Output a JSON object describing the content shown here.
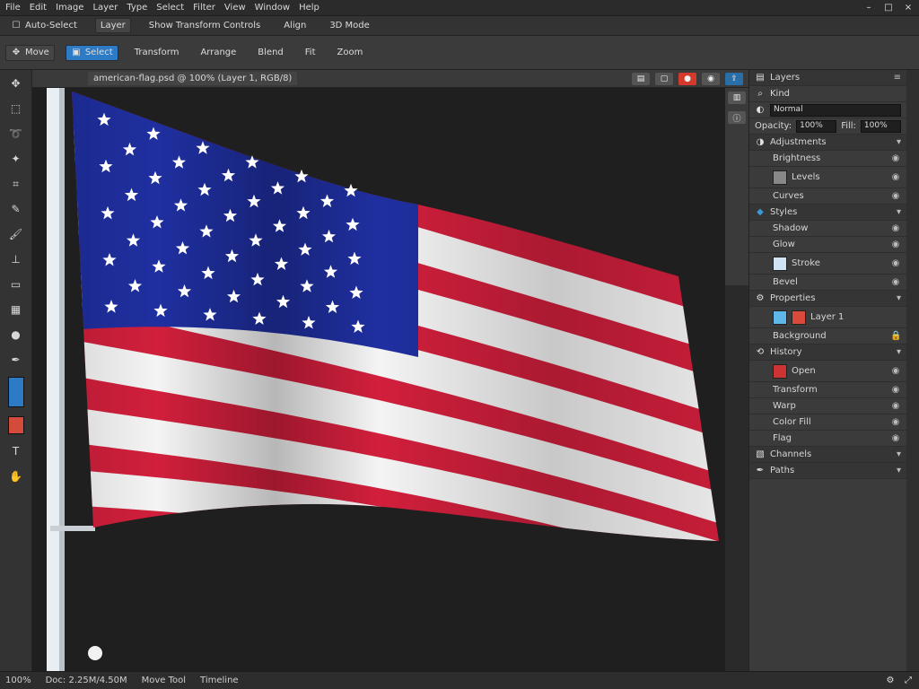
{
  "menubar": {
    "items": [
      "File",
      "Edit",
      "Image",
      "Layer",
      "Type",
      "Select",
      "Filter",
      "View",
      "Window",
      "Help"
    ],
    "window_controls": [
      "minimize",
      "maximize",
      "close"
    ]
  },
  "options_bar": {
    "items": [
      "Auto-Select",
      "Layer",
      "Show Transform Controls",
      "Align",
      "3D Mode"
    ]
  },
  "toolbar2": {
    "buttons": [
      "Move",
      "Select",
      "Transform",
      "Arrange",
      "Blend",
      "Fit",
      "Zoom"
    ]
  },
  "document": {
    "tab_title": "american-flag.psd @ 100% (Layer 1, RGB/8)",
    "close_label": "×"
  },
  "tools": [
    "move-icon",
    "marquee-icon",
    "lasso-icon",
    "wand-icon",
    "crop-icon",
    "eyedropper-icon",
    "brush-icon",
    "stamp-icon",
    "eraser-icon",
    "gradient-icon",
    "dodge-icon",
    "pen-icon",
    "type-icon",
    "path-icon",
    "shape-icon",
    "hand-icon"
  ],
  "colors": {
    "foreground": "#2d7bc4",
    "background": "#d34b3a",
    "flag_red": "#d11f3c",
    "flag_blue": "#1f2fa0",
    "flag_white": "#f4f4f4"
  },
  "panels": {
    "layers_title": "Layers",
    "channels_title": "Channels",
    "paths_title": "Paths",
    "search_placeholder": "Kind",
    "blend_mode": "Normal",
    "opacity_label": "Opacity:",
    "opacity_value": "100%",
    "fill_label": "Fill:",
    "fill_value": "100%",
    "groups": [
      {
        "name": "Adjustments",
        "items": [
          "Brightness",
          "Levels",
          "Curves"
        ]
      },
      {
        "name": "Styles",
        "items": [
          "Shadow",
          "Glow",
          "Stroke",
          "Bevel"
        ]
      },
      {
        "name": "Properties",
        "items": [
          "Layer 1",
          "Background"
        ]
      },
      {
        "name": "History",
        "items": [
          "Open",
          "Transform",
          "Warp",
          "Color Fill",
          "Flag"
        ]
      }
    ]
  },
  "statusbar": {
    "zoom": "100%",
    "doc_info": "Doc: 2.25M/4.50M",
    "tool": "Move Tool",
    "extra": "Timeline"
  }
}
